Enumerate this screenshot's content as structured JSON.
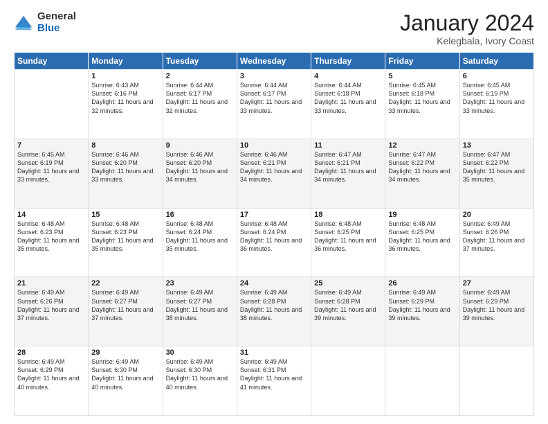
{
  "logo": {
    "general": "General",
    "blue": "Blue"
  },
  "title": "January 2024",
  "subtitle": "Kelegbala, Ivory Coast",
  "weekdays": [
    "Sunday",
    "Monday",
    "Tuesday",
    "Wednesday",
    "Thursday",
    "Friday",
    "Saturday"
  ],
  "weeks": [
    [
      {
        "day": "",
        "sunrise": "",
        "sunset": "",
        "daylight": ""
      },
      {
        "day": "1",
        "sunrise": "Sunrise: 6:43 AM",
        "sunset": "Sunset: 6:16 PM",
        "daylight": "Daylight: 11 hours and 32 minutes."
      },
      {
        "day": "2",
        "sunrise": "Sunrise: 6:44 AM",
        "sunset": "Sunset: 6:17 PM",
        "daylight": "Daylight: 11 hours and 32 minutes."
      },
      {
        "day": "3",
        "sunrise": "Sunrise: 6:44 AM",
        "sunset": "Sunset: 6:17 PM",
        "daylight": "Daylight: 11 hours and 33 minutes."
      },
      {
        "day": "4",
        "sunrise": "Sunrise: 6:44 AM",
        "sunset": "Sunset: 6:18 PM",
        "daylight": "Daylight: 11 hours and 33 minutes."
      },
      {
        "day": "5",
        "sunrise": "Sunrise: 6:45 AM",
        "sunset": "Sunset: 6:18 PM",
        "daylight": "Daylight: 11 hours and 33 minutes."
      },
      {
        "day": "6",
        "sunrise": "Sunrise: 6:45 AM",
        "sunset": "Sunset: 6:19 PM",
        "daylight": "Daylight: 11 hours and 33 minutes."
      }
    ],
    [
      {
        "day": "7",
        "sunrise": "Sunrise: 6:45 AM",
        "sunset": "Sunset: 6:19 PM",
        "daylight": "Daylight: 11 hours and 33 minutes."
      },
      {
        "day": "8",
        "sunrise": "Sunrise: 6:46 AM",
        "sunset": "Sunset: 6:20 PM",
        "daylight": "Daylight: 11 hours and 33 minutes."
      },
      {
        "day": "9",
        "sunrise": "Sunrise: 6:46 AM",
        "sunset": "Sunset: 6:20 PM",
        "daylight": "Daylight: 11 hours and 34 minutes."
      },
      {
        "day": "10",
        "sunrise": "Sunrise: 6:46 AM",
        "sunset": "Sunset: 6:21 PM",
        "daylight": "Daylight: 11 hours and 34 minutes."
      },
      {
        "day": "11",
        "sunrise": "Sunrise: 6:47 AM",
        "sunset": "Sunset: 6:21 PM",
        "daylight": "Daylight: 11 hours and 34 minutes."
      },
      {
        "day": "12",
        "sunrise": "Sunrise: 6:47 AM",
        "sunset": "Sunset: 6:22 PM",
        "daylight": "Daylight: 11 hours and 34 minutes."
      },
      {
        "day": "13",
        "sunrise": "Sunrise: 6:47 AM",
        "sunset": "Sunset: 6:22 PM",
        "daylight": "Daylight: 11 hours and 35 minutes."
      }
    ],
    [
      {
        "day": "14",
        "sunrise": "Sunrise: 6:48 AM",
        "sunset": "Sunset: 6:23 PM",
        "daylight": "Daylight: 11 hours and 35 minutes."
      },
      {
        "day": "15",
        "sunrise": "Sunrise: 6:48 AM",
        "sunset": "Sunset: 6:23 PM",
        "daylight": "Daylight: 11 hours and 35 minutes."
      },
      {
        "day": "16",
        "sunrise": "Sunrise: 6:48 AM",
        "sunset": "Sunset: 6:24 PM",
        "daylight": "Daylight: 11 hours and 35 minutes."
      },
      {
        "day": "17",
        "sunrise": "Sunrise: 6:48 AM",
        "sunset": "Sunset: 6:24 PM",
        "daylight": "Daylight: 11 hours and 36 minutes."
      },
      {
        "day": "18",
        "sunrise": "Sunrise: 6:48 AM",
        "sunset": "Sunset: 6:25 PM",
        "daylight": "Daylight: 11 hours and 36 minutes."
      },
      {
        "day": "19",
        "sunrise": "Sunrise: 6:48 AM",
        "sunset": "Sunset: 6:25 PM",
        "daylight": "Daylight: 11 hours and 36 minutes."
      },
      {
        "day": "20",
        "sunrise": "Sunrise: 6:49 AM",
        "sunset": "Sunset: 6:26 PM",
        "daylight": "Daylight: 11 hours and 37 minutes."
      }
    ],
    [
      {
        "day": "21",
        "sunrise": "Sunrise: 6:49 AM",
        "sunset": "Sunset: 6:26 PM",
        "daylight": "Daylight: 11 hours and 37 minutes."
      },
      {
        "day": "22",
        "sunrise": "Sunrise: 6:49 AM",
        "sunset": "Sunset: 6:27 PM",
        "daylight": "Daylight: 11 hours and 37 minutes."
      },
      {
        "day": "23",
        "sunrise": "Sunrise: 6:49 AM",
        "sunset": "Sunset: 6:27 PM",
        "daylight": "Daylight: 11 hours and 38 minutes."
      },
      {
        "day": "24",
        "sunrise": "Sunrise: 6:49 AM",
        "sunset": "Sunset: 6:28 PM",
        "daylight": "Daylight: 11 hours and 38 minutes."
      },
      {
        "day": "25",
        "sunrise": "Sunrise: 6:49 AM",
        "sunset": "Sunset: 6:28 PM",
        "daylight": "Daylight: 11 hours and 39 minutes."
      },
      {
        "day": "26",
        "sunrise": "Sunrise: 6:49 AM",
        "sunset": "Sunset: 6:29 PM",
        "daylight": "Daylight: 11 hours and 39 minutes."
      },
      {
        "day": "27",
        "sunrise": "Sunrise: 6:49 AM",
        "sunset": "Sunset: 6:29 PM",
        "daylight": "Daylight: 11 hours and 39 minutes."
      }
    ],
    [
      {
        "day": "28",
        "sunrise": "Sunrise: 6:49 AM",
        "sunset": "Sunset: 6:29 PM",
        "daylight": "Daylight: 11 hours and 40 minutes."
      },
      {
        "day": "29",
        "sunrise": "Sunrise: 6:49 AM",
        "sunset": "Sunset: 6:30 PM",
        "daylight": "Daylight: 11 hours and 40 minutes."
      },
      {
        "day": "30",
        "sunrise": "Sunrise: 6:49 AM",
        "sunset": "Sunset: 6:30 PM",
        "daylight": "Daylight: 11 hours and 40 minutes."
      },
      {
        "day": "31",
        "sunrise": "Sunrise: 6:49 AM",
        "sunset": "Sunset: 6:31 PM",
        "daylight": "Daylight: 11 hours and 41 minutes."
      },
      {
        "day": "",
        "sunrise": "",
        "sunset": "",
        "daylight": ""
      },
      {
        "day": "",
        "sunrise": "",
        "sunset": "",
        "daylight": ""
      },
      {
        "day": "",
        "sunrise": "",
        "sunset": "",
        "daylight": ""
      }
    ]
  ]
}
